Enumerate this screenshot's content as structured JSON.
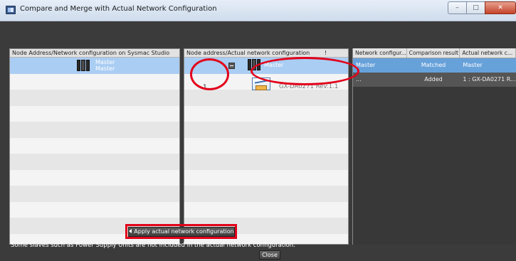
{
  "window": {
    "title": "Compare and Merge with Actual Network Configuration",
    "minimize_glyph": "–",
    "maximize_glyph": "□",
    "close_glyph": "✕"
  },
  "left_panel": {
    "header": "Node Address/Network configuration on Sysmac Studio",
    "master_line1": "Master",
    "master_line2": "Master"
  },
  "mid_panel": {
    "header": "Node address/Actual network configuration",
    "header_marker": "!",
    "master_label": "Master",
    "slave_node": "1",
    "slave_label": "GX-DA0271 Rev:1.1"
  },
  "right_table": {
    "columns": [
      "Network configur...",
      "Comparison result",
      "Actual network c..."
    ],
    "rows": [
      [
        "Master",
        "Matched",
        "Master"
      ],
      [
        "...",
        "Added",
        "1 : GX-DA0271 R..."
      ]
    ]
  },
  "footer": {
    "apply_label": "Apply actual network configuration",
    "note": "Some slaves such as Power Supply Units are not included in the actual network configuration.",
    "close_label": "Close"
  },
  "icons": {
    "app": "app-window-icon",
    "plc": "plc-controller-icon",
    "slave": "slave-device-icon",
    "collapse": "collapse-icon"
  },
  "colors": {
    "selection": "#aacdf3",
    "table_master_row": "#67a1da",
    "annotation_red": "#e2001a",
    "dark_background": "#3b3b3b"
  }
}
